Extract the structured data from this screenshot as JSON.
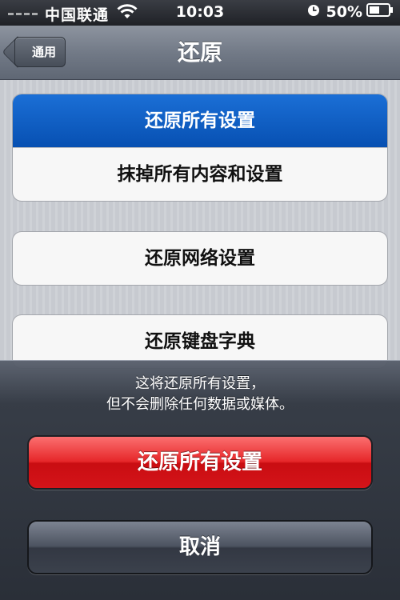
{
  "status_bar": {
    "carrier": "中国联通",
    "time": "10:03",
    "battery": "50%",
    "icons": [
      "signal-dots-icon",
      "wifi-icon",
      "clock-icon",
      "battery-icon"
    ]
  },
  "nav": {
    "back_label": "通用",
    "title": "还原"
  },
  "groups": [
    {
      "rows": [
        {
          "label": "还原所有设置",
          "selected": true
        },
        {
          "label": "抹掉所有内容和设置",
          "selected": false
        }
      ]
    },
    {
      "rows": [
        {
          "label": "还原网络设置",
          "selected": false
        }
      ]
    },
    {
      "rows": [
        {
          "label": "还原键盘字典",
          "selected": false
        }
      ]
    }
  ],
  "action_sheet": {
    "message_line1": "这将还原所有设置，",
    "message_line2": "但不会删除任何数据或媒体。",
    "confirm_label": "还原所有设置",
    "cancel_label": "取消"
  },
  "colors": {
    "selected_row": "#0a58c2",
    "destructive": "#e02226",
    "nav_bar": "#737b88"
  }
}
